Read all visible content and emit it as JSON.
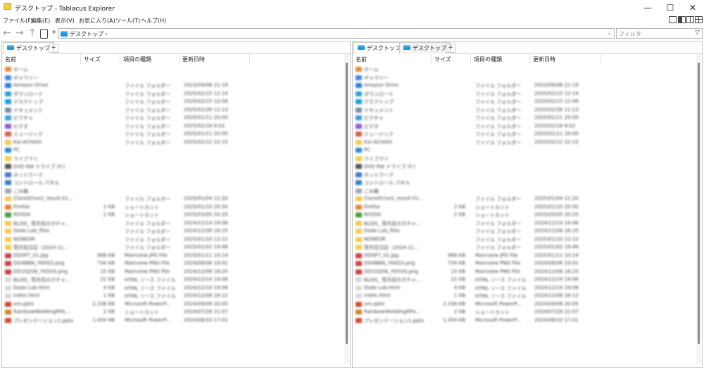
{
  "window": {
    "title": "デスクトップ - Tablacus Explorer",
    "minimize": "—",
    "maximize": "☐",
    "close": "✕"
  },
  "menu": [
    "ファイル(F)",
    "編集(E)",
    "表示(V)",
    "お気に入り(A)",
    "ツール(T)",
    "ヘルプ(H)"
  ],
  "toolbar": {
    "back": "←",
    "forward": "→",
    "up": "↑",
    "address": "デスクトップ ›",
    "filter_placeholder": "フィルタ",
    "plus": "+"
  },
  "columns": {
    "name": "名前",
    "size": "サイズ",
    "type": "項目の種類",
    "modified": "更新日時"
  },
  "left_pane": {
    "tabs": [
      "デスクトップ"
    ],
    "tab_add": "+"
  },
  "right_pane": {
    "tabs": [
      "デスクトップ",
      "デスクトップ"
    ],
    "tab_add": "+"
  },
  "files": [
    {
      "name": "ホーム",
      "size": "",
      "type": "",
      "date": "",
      "color": "#e88a3a"
    },
    {
      "name": "ギャラリー",
      "size": "",
      "type": "",
      "date": "",
      "color": "#3a8be0"
    },
    {
      "name": "Amazon Drive",
      "size": "",
      "type": "ファイル フォルダー",
      "date": "2023/09/08 21:19",
      "color": "#2d7fd6"
    },
    {
      "name": "ダウンロード",
      "size": "",
      "type": "ファイル フォルダー",
      "date": "2025/02/15 12:14",
      "color": "#2aa0d8"
    },
    {
      "name": "デスクトップ",
      "size": "",
      "type": "ファイル フォルダー",
      "date": "2025/02/15 12:08",
      "color": "#1a9be0"
    },
    {
      "name": "ドキュメント",
      "size": "",
      "type": "ファイル フォルダー",
      "date": "2025/02/26 11:13",
      "color": "#7a8aa8"
    },
    {
      "name": "ピクチャ",
      "size": "",
      "type": "ファイル フォルダー",
      "date": "2025/01/11 20:00",
      "color": "#3a9ce0"
    },
    {
      "name": "ビデオ",
      "size": "",
      "type": "ファイル フォルダー",
      "date": "2025/02/18 8:02",
      "color": "#8a5ad8"
    },
    {
      "name": "ミュージック",
      "size": "",
      "type": "ファイル フォルダー",
      "date": "2025/01/11 20:00",
      "color": "#e0584a"
    },
    {
      "name": "Kai-ACHAGI",
      "size": "",
      "type": "ファイル フォルダー",
      "date": "2025/02/12 22:15",
      "color": "#f5c94c"
    },
    {
      "name": "PC",
      "size": "",
      "type": "",
      "date": "",
      "color": "#2a8ad0"
    },
    {
      "name": "ライブラリ",
      "size": "",
      "type": "",
      "date": "",
      "color": "#f5c94c"
    },
    {
      "name": "DVD RW ドライブ (F:)",
      "size": "",
      "type": "",
      "date": "",
      "color": "#555555"
    },
    {
      "name": "ネットワーク",
      "size": "",
      "type": "",
      "date": "",
      "color": "#3a7ad0"
    },
    {
      "name": "コントロール パネル",
      "size": "",
      "type": "",
      "date": "",
      "color": "#3a7ad0"
    },
    {
      "name": "ごみ箱",
      "size": "",
      "type": "",
      "date": "",
      "color": "#9aa8b8"
    },
    {
      "name": "CloneDrive2_result-01...",
      "size": "",
      "type": "ファイル フォルダー",
      "date": "2025/01/04 11:20",
      "color": "#f5c94c"
    },
    {
      "name": "Firefox",
      "size": "2 KB",
      "type": "ショートカット",
      "date": "2025/01/10 20:50",
      "color": "#e8823a"
    },
    {
      "name": "NVIDIA",
      "size": "2 KB",
      "type": "ショートカット",
      "date": "2025/03/05 20:25",
      "color": "#4a9a3a"
    },
    {
      "name": "BLOG_ 雪月花のガチャ...",
      "size": "",
      "type": "ファイル フォルダー",
      "date": "2024/12/14 19:06",
      "color": "#f5c94c"
    },
    {
      "name": "Dodo Lab_files",
      "size": "",
      "type": "ファイル フォルダー",
      "date": "2024/12/08 16:25",
      "color": "#f5c94c"
    },
    {
      "name": "NONEOR",
      "size": "",
      "type": "ファイル フォルダー",
      "date": "2025/01/10 12:12",
      "color": "#f5c94c"
    },
    {
      "name": "雪月花日記（2024-11...",
      "size": "",
      "type": "ファイル フォルダー",
      "date": "2025/01/02 19:48",
      "color": "#f5c94c"
    },
    {
      "name": "DD0P7_01.jpg",
      "size": "968 KB",
      "type": "Mainview JPG File",
      "date": "2025/01/11 10:14",
      "color": "#c84040"
    },
    {
      "name": "DD4BBN_YKKG3.png",
      "size": "734 KB",
      "type": "Mainview PNG File",
      "date": "2024/08/06 19:01",
      "color": "#c84040"
    },
    {
      "name": "DD1GZ06_YK5VG.png",
      "size": "15 KB",
      "type": "Mainview PNG File",
      "date": "2024/12/08 16:25",
      "color": "#c84040"
    },
    {
      "name": "BLOG_ 雪月花のガチャ...",
      "size": "22 KB",
      "type": "HTML ソース ファイル",
      "date": "2024/12/14 19:06",
      "color": "#d8d8d8"
    },
    {
      "name": "Dodo Lab.html",
      "size": "4 KB",
      "type": "HTML ソース ファイル",
      "date": "2024/12/14 19:06",
      "color": "#d8d8d8"
    },
    {
      "name": "index.html",
      "size": "1 KB",
      "type": "HTML ソース ファイル",
      "date": "2024/12/08 16:12",
      "color": "#d8d8d8"
    },
    {
      "name": "ore.pptx",
      "size": "2,338 KB",
      "type": "Microsoft PowerP...",
      "date": "2024/09/08 20:05",
      "color": "#d0482a"
    },
    {
      "name": "RainbowWeddingRPa...",
      "size": "2 KB",
      "type": "ショートカット",
      "date": "2024/07/28 21:07",
      "color": "#c88a2a"
    },
    {
      "name": "プレゼンテーション1.pptx",
      "size": "1,454 KB",
      "type": "Microsoft PowerP...",
      "date": "2024/08/10 17:01",
      "color": "#d0482a"
    }
  ]
}
